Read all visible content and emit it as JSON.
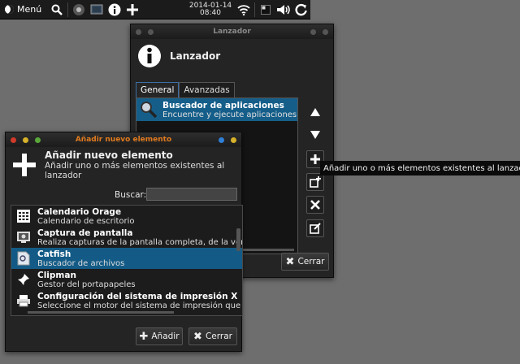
{
  "panel": {
    "menu_label": "Menú",
    "clock_date": "2014-01-14",
    "clock_time": "08:40",
    "launchers": [
      "search-icon",
      "browser-icon",
      "screen-icon",
      "info-icon",
      "add-icon"
    ],
    "tray": [
      "wifi-icon",
      "workspace-icon",
      "volume-icon",
      "power-icon"
    ]
  },
  "lanzador": {
    "window_title": "Lanzador",
    "header_title": "Lanzador",
    "tabs": [
      {
        "label": "General",
        "active": true
      },
      {
        "label": "Avanzadas",
        "active": false
      }
    ],
    "items": [
      {
        "name": "Buscador de aplicaciones",
        "desc": "Encuentre y ejecute aplicaciones inst",
        "icon": "magnifier-icon",
        "selected": true
      }
    ],
    "side_buttons": [
      "move-up-icon",
      "move-down-icon",
      "add-item-icon",
      "add-empty-icon",
      "remove-icon",
      "edit-icon"
    ],
    "close_label": "Cerrar",
    "tooltip": "Añadir uno o más elementos existentes al lanzador"
  },
  "anadir": {
    "window_title": "Añadir nuevo elemento",
    "header_title": "Añadir nuevo elemento",
    "header_subtitle": "Añadir uno o más elementos existentes al lanzador",
    "search_label": "Buscar:",
    "search_value": "",
    "items": [
      {
        "name": "Calendario Orage",
        "desc": "Calendario de escritorio",
        "icon": "calendar-icon",
        "selected": false
      },
      {
        "name": "Captura de pantalla",
        "desc": "Realiza capturas de la pantalla completa, de la vent",
        "icon": "screenshot-icon",
        "selected": false
      },
      {
        "name": "Catfish",
        "desc": "Buscador de archivos",
        "icon": "file-search-icon",
        "selected": true
      },
      {
        "name": "Clipman",
        "desc": "Gestor del portapapeles",
        "icon": "pin-icon",
        "selected": false
      },
      {
        "name": "Configuración del sistema de impresión X",
        "desc": "Seleccione el motor del sistema de impresión que v",
        "icon": "printer-icon",
        "selected": false
      }
    ],
    "add_label": "Añadir",
    "close_label": "Cerrar",
    "colors": {
      "title": "#e07a1f",
      "selection": "#135b86",
      "dot_red": "#d03a2a",
      "dot_yellow": "#d6b12a",
      "dot_green": "#5aa83a",
      "dot_blue": "#2f7fd6"
    }
  }
}
